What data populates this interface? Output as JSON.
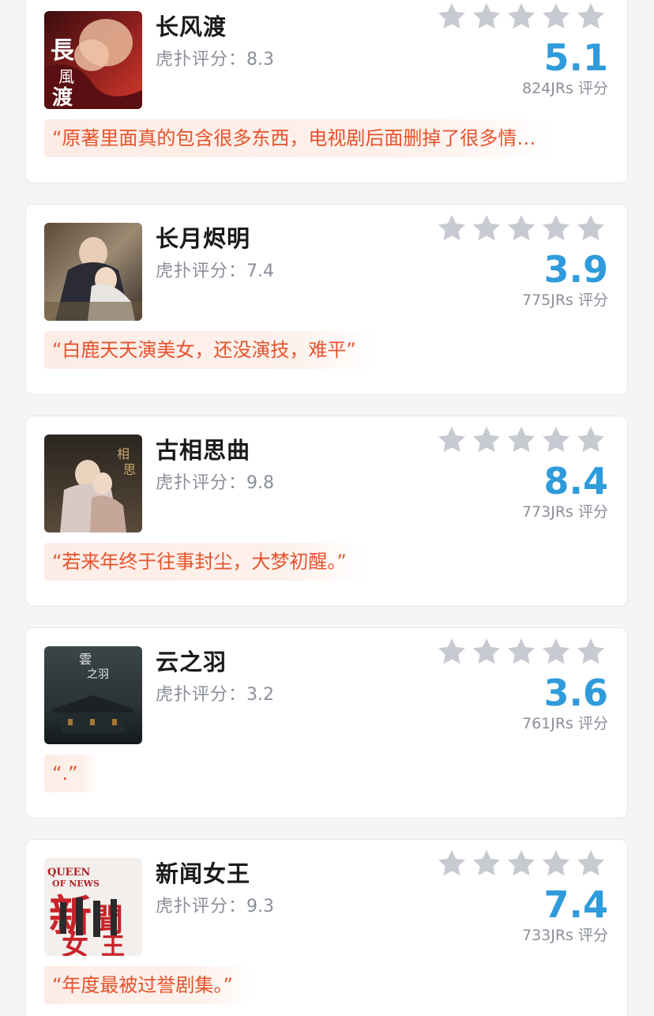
{
  "rating_list": [
    {
      "title": "长风渡",
      "hupu_label": "虎扑评分：",
      "hupu_score": "8.3",
      "star_rating": 0,
      "score": "5.1",
      "count_label": "824JRs 评分",
      "quote": "“原著里面真的包含很多东西，电视剧后面删掉了很多情…",
      "poster_icon": "poster-image",
      "poster_text": "長風渡"
    },
    {
      "title": "长月烬明",
      "hupu_label": "虎扑评分：",
      "hupu_score": "7.4",
      "star_rating": 0,
      "score": "3.9",
      "count_label": "775JRs 评分",
      "quote": "“白鹿天天演美女，还没演技，难平”",
      "poster_icon": "poster-image",
      "poster_text": ""
    },
    {
      "title": "古相思曲",
      "hupu_label": "虎扑评分：",
      "hupu_score": "9.8",
      "star_rating": 0,
      "score": "8.4",
      "count_label": "773JRs 评分",
      "quote": "“若来年终于往事封尘，大梦初醒。”",
      "poster_icon": "poster-image",
      "poster_text": ""
    },
    {
      "title": "云之羽",
      "hupu_label": "虎扑评分：",
      "hupu_score": "3.2",
      "star_rating": 0,
      "score": "3.6",
      "count_label": "761JRs 评分",
      "quote": "“.”",
      "poster_icon": "poster-image",
      "poster_text": "雲之羽"
    },
    {
      "title": "新闻女王",
      "hupu_label": "虎扑评分：",
      "hupu_score": "9.3",
      "star_rating": 0,
      "score": "7.4",
      "count_label": "733JRs 评分",
      "quote": "“年度最被过誉剧集。”",
      "poster_icon": "poster-image",
      "poster_text": "新聞女王"
    }
  ],
  "colors": {
    "score": "#2f9bdb",
    "quote_text": "#e5532d",
    "quote_bg": "#fdece6",
    "star_inactive": "#c8cad1",
    "background": "#f4f5f7"
  },
  "icons": {
    "star": "star-icon"
  }
}
